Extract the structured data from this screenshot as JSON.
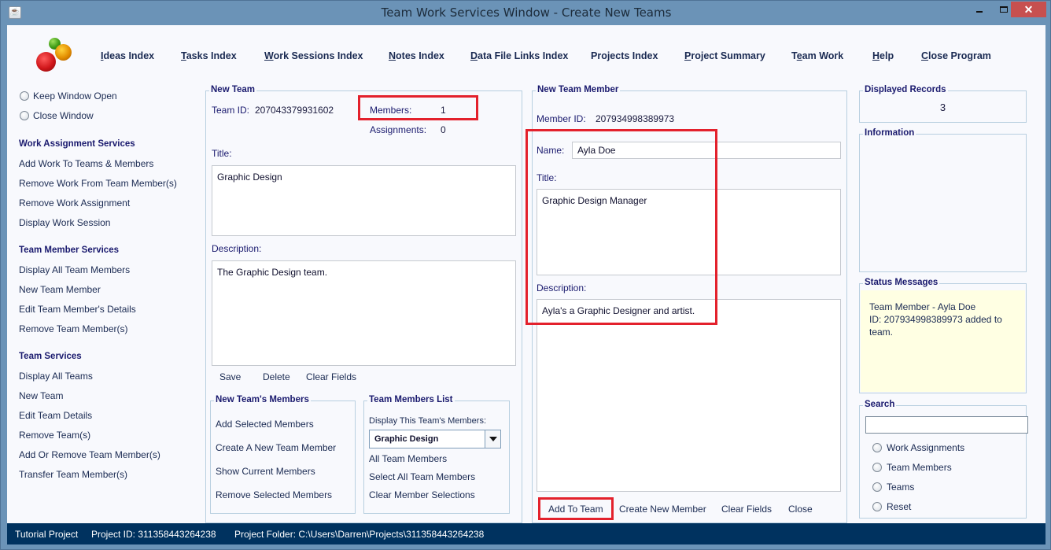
{
  "window": {
    "title": "Team Work Services Window - Create New Teams",
    "controls": {
      "minimize": "minimize",
      "maximize": "maximize",
      "close": "✕"
    }
  },
  "nav": [
    {
      "label": "Ideas Index",
      "mnemonic": "I"
    },
    {
      "label": "Tasks Index",
      "mnemonic": "T"
    },
    {
      "label": "Work Sessions Index",
      "mnemonic": "W"
    },
    {
      "label": "Notes Index",
      "mnemonic": "N"
    },
    {
      "label": "Data File Links Index",
      "mnemonic": "D"
    },
    {
      "label": "Projects Index",
      "mnemonic": ""
    },
    {
      "label": "Project Summary",
      "mnemonic": "P"
    },
    {
      "label": "Team Work",
      "mnemonic": "e"
    },
    {
      "label": "Help",
      "mnemonic": "H"
    },
    {
      "label": "Close Program",
      "mnemonic": "C"
    }
  ],
  "sidebar": {
    "radios": [
      {
        "label": "Keep Window Open",
        "selected": false
      },
      {
        "label": "Close Window",
        "selected": false
      }
    ],
    "sections": [
      {
        "heading": "Work Assignment Services",
        "items": [
          "Add Work To Teams & Members",
          "Remove Work From Team Member(s)",
          "Remove Work Assignment",
          "Display Work Session"
        ]
      },
      {
        "heading": "Team Member Services",
        "items": [
          "Display All Team Members",
          "New Team Member",
          "Edit Team Member's Details",
          "Remove Team Member(s)"
        ]
      },
      {
        "heading": "Team Services",
        "items": [
          "Display All Teams",
          "New Team",
          "Edit Team Details",
          "Remove Team(s)",
          "Add Or Remove Team Member(s)",
          "Transfer Team Member(s)"
        ]
      }
    ]
  },
  "new_team": {
    "group_title": "New Team",
    "team_id_label": "Team ID:",
    "team_id": "207043379931602",
    "members_label": "Members:",
    "members": "1",
    "assignments_label": "Assignments:",
    "assignments": "0",
    "title_label": "Title:",
    "title_value": "Graphic Design",
    "description_label": "Description:",
    "description_value": "The Graphic Design team.",
    "buttons": {
      "save": "Save",
      "delete": "Delete",
      "clear": "Clear Fields"
    },
    "members_group": {
      "title": "New Team's Members",
      "actions": [
        "Add Selected Members",
        "Create A New Team Member",
        "Show Current Members",
        "Remove Selected Members"
      ]
    },
    "members_list_group": {
      "title": "Team Members List",
      "display_label": "Display This Team's Members:",
      "selected_team": "Graphic Design",
      "actions": [
        "All Team Members",
        "Select All Team Members",
        "Clear Member Selections"
      ]
    }
  },
  "new_member": {
    "group_title": "New Team Member",
    "member_id_label": "Member ID:",
    "member_id": "207934998389973",
    "name_label": "Name:",
    "name_value": "Ayla Doe",
    "title_label": "Title:",
    "title_value": "Graphic Design Manager",
    "description_label": "Description:",
    "description_value": "Ayla's a Graphic Designer and artist.",
    "buttons": {
      "add": "Add To Team",
      "create": "Create New Member",
      "clear": "Clear Fields",
      "close": "Close"
    }
  },
  "right_panel": {
    "displayed_records_title": "Displayed Records",
    "displayed_records": "3",
    "information_title": "Information",
    "status_title": "Status Messages",
    "status_message": "Team Member - Ayla Doe\nID: 207934998389973 added to\nteam.",
    "search_title": "Search",
    "search_value": "",
    "search_options": [
      "Work Assignments",
      "Team Members",
      "Teams",
      "Reset"
    ]
  },
  "statusbar": {
    "project_name": "Tutorial Project",
    "project_id": "Project ID:  311358443264238",
    "project_folder": "Project Folder: C:\\Users\\Darren\\Projects\\311358443264238"
  },
  "colors": {
    "titlebar": "#6b93b7",
    "statusbar": "#00325f",
    "highlight": "#e3212c",
    "status_bg": "#ffffe3",
    "close_button": "#c7504f"
  }
}
